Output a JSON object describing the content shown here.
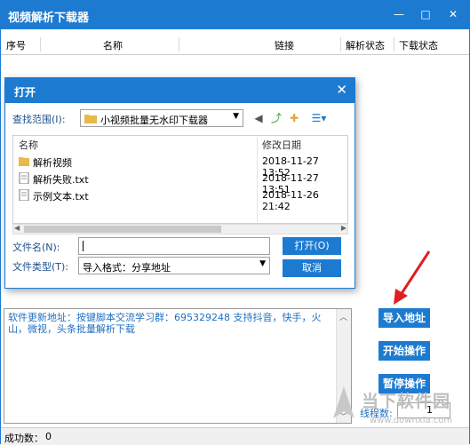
{
  "window": {
    "title": "视频解析下载器",
    "min_glyph": "—",
    "max_glyph": "□",
    "close_glyph": "✕"
  },
  "list": {
    "columns": [
      "序号",
      "名称",
      "链接",
      "解析状态",
      "下载状态"
    ]
  },
  "dialog": {
    "title": "打开",
    "close_glyph": "✕",
    "look_in_label": "查找范围(I):",
    "look_in_value": "小视频批量无水印下载器",
    "col_name": "名称",
    "col_date": "修改日期",
    "files": [
      {
        "name": "解析视频",
        "date": "2018-11-27 13:52",
        "kind": "folder"
      },
      {
        "name": "解析失败.txt",
        "date": "2018-11-27 13:51",
        "kind": "file"
      },
      {
        "name": "示例文本.txt",
        "date": "2018-11-26 21:42",
        "kind": "file"
      }
    ],
    "filename_label": "文件名(N):",
    "filename_value": "",
    "filetype_label": "文件类型(T):",
    "filetype_value": "导入格式：分享地址",
    "open_button": "打开(O)",
    "cancel_button": "取消"
  },
  "log": {
    "text": "软件更新地址：按键脚本交流学习群：695329248 支持抖音，快手，火山，微视，头条批量解析下载"
  },
  "buttons": {
    "import": "导入地址",
    "start": "开始操作",
    "pause": "暂停操作"
  },
  "threads": {
    "label": "线程数:",
    "value": "1"
  },
  "status": {
    "label": "成功数：",
    "value": "0"
  },
  "watermark": {
    "brand": "当下软件园",
    "url": "www.downxia.com"
  },
  "colors": {
    "accent": "#1c7bd1",
    "arrow": "#e02020"
  }
}
